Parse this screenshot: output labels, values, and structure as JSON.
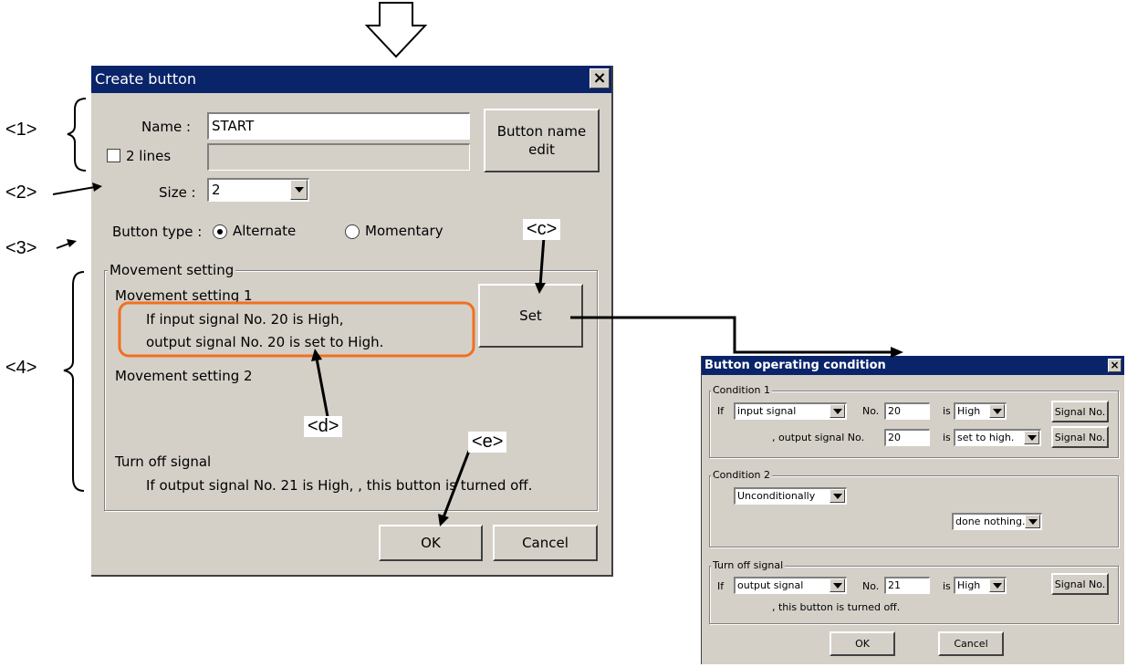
{
  "callouts": {
    "c1": "<1>",
    "c2": "<2>",
    "c3": "<3>",
    "c4": "<4>",
    "cc": "<c>",
    "cd": "<d>",
    "ce": "<e>"
  },
  "dialog1": {
    "title": "Create button",
    "close": "×",
    "name_label": "Name :",
    "name_value": "START",
    "two_lines_label": "2 lines",
    "button_name_edit": "Button name edit",
    "size_label": "Size :",
    "size_value": "2",
    "button_type_label": "Button type :",
    "alternate": "Alternate",
    "momentary": "Momentary",
    "movement_group": "Movement setting",
    "movement1_title": "Movement setting 1",
    "movement1_line1": "If input signal No. 20 is High,",
    "movement1_line2": "output signal No. 20 is set to High.",
    "set_button": "Set",
    "movement2_title": "Movement setting 2",
    "turnoff_title": "Turn off signal",
    "turnoff_line": "If output signal No. 21 is High, , this button is turned off.",
    "ok": "OK",
    "cancel": "Cancel"
  },
  "dialog2": {
    "title": "Button operating condition",
    "close": "×",
    "condition1": {
      "legend": "Condition 1",
      "if": "If",
      "signal_type": "input signal",
      "no_label": "No.",
      "no_value": "20",
      "is_label": "is",
      "state": "High",
      "signal_no_button": "Signal No.",
      "output_label": ", output signal No.",
      "output_no": "20",
      "is_label2": "is",
      "action": "set to high.",
      "signal_no_button2": "Signal No."
    },
    "condition2": {
      "legend": "Condition 2",
      "mode": "Unconditionally",
      "action": "done nothing."
    },
    "turnoff": {
      "legend": "Turn off signal",
      "if": "If",
      "signal_type": "output signal",
      "no_label": "No.",
      "no_value": "21",
      "is_label": "is",
      "state": "High",
      "signal_no_button": "Signal No.",
      "tail": ", this button is turned off."
    },
    "ok": "OK",
    "cancel": "Cancel"
  }
}
